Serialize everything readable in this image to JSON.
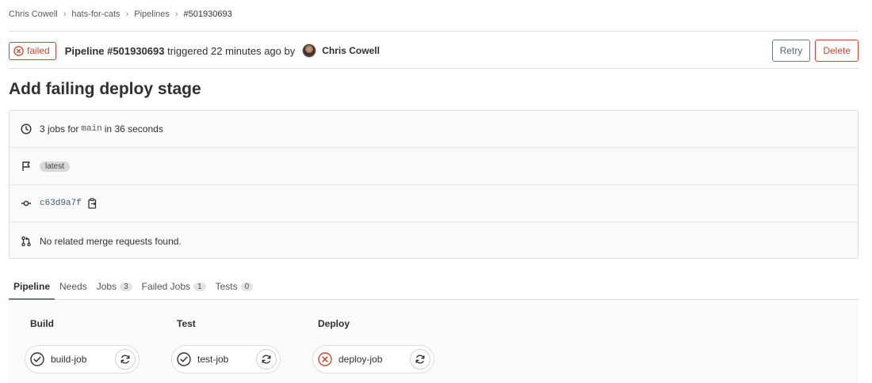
{
  "breadcrumb": [
    "Chris Cowell",
    "hats-for-cats",
    "Pipelines",
    "#501930693"
  ],
  "header": {
    "status": "failed",
    "pipeline_id": "Pipeline #501930693",
    "triggered_text": "triggered 22 minutes ago by",
    "author": "Chris Cowell",
    "retry_label": "Retry",
    "delete_label": "Delete"
  },
  "commit_title": "Add failing deploy stage",
  "info": {
    "jobs_prefix": "3 jobs for",
    "branch": "main",
    "jobs_suffix": "in 36 seconds",
    "tag": "latest",
    "sha": "c63d9a7f",
    "merge_requests": "No related merge requests found."
  },
  "tabs": [
    {
      "label": "Pipeline",
      "count": null
    },
    {
      "label": "Needs",
      "count": null
    },
    {
      "label": "Jobs",
      "count": "3"
    },
    {
      "label": "Failed Jobs",
      "count": "1"
    },
    {
      "label": "Tests",
      "count": "0"
    }
  ],
  "stages": [
    {
      "title": "Build",
      "job": "build-job",
      "status": "passed"
    },
    {
      "title": "Test",
      "job": "test-job",
      "status": "passed"
    },
    {
      "title": "Deploy",
      "job": "deploy-job",
      "status": "failed"
    }
  ],
  "colors": {
    "failed": "#c8492f",
    "passed": "#303030",
    "secondary_button": "#6b7b89"
  },
  "icons": {
    "status_failed": "x-circle-icon",
    "clock": "clock-icon",
    "flag": "flag-icon",
    "commit": "commit-icon",
    "copy": "clipboard-icon",
    "merge_request": "merge-request-icon",
    "job_passed": "check-circle-icon",
    "job_retry": "retry-icon"
  }
}
